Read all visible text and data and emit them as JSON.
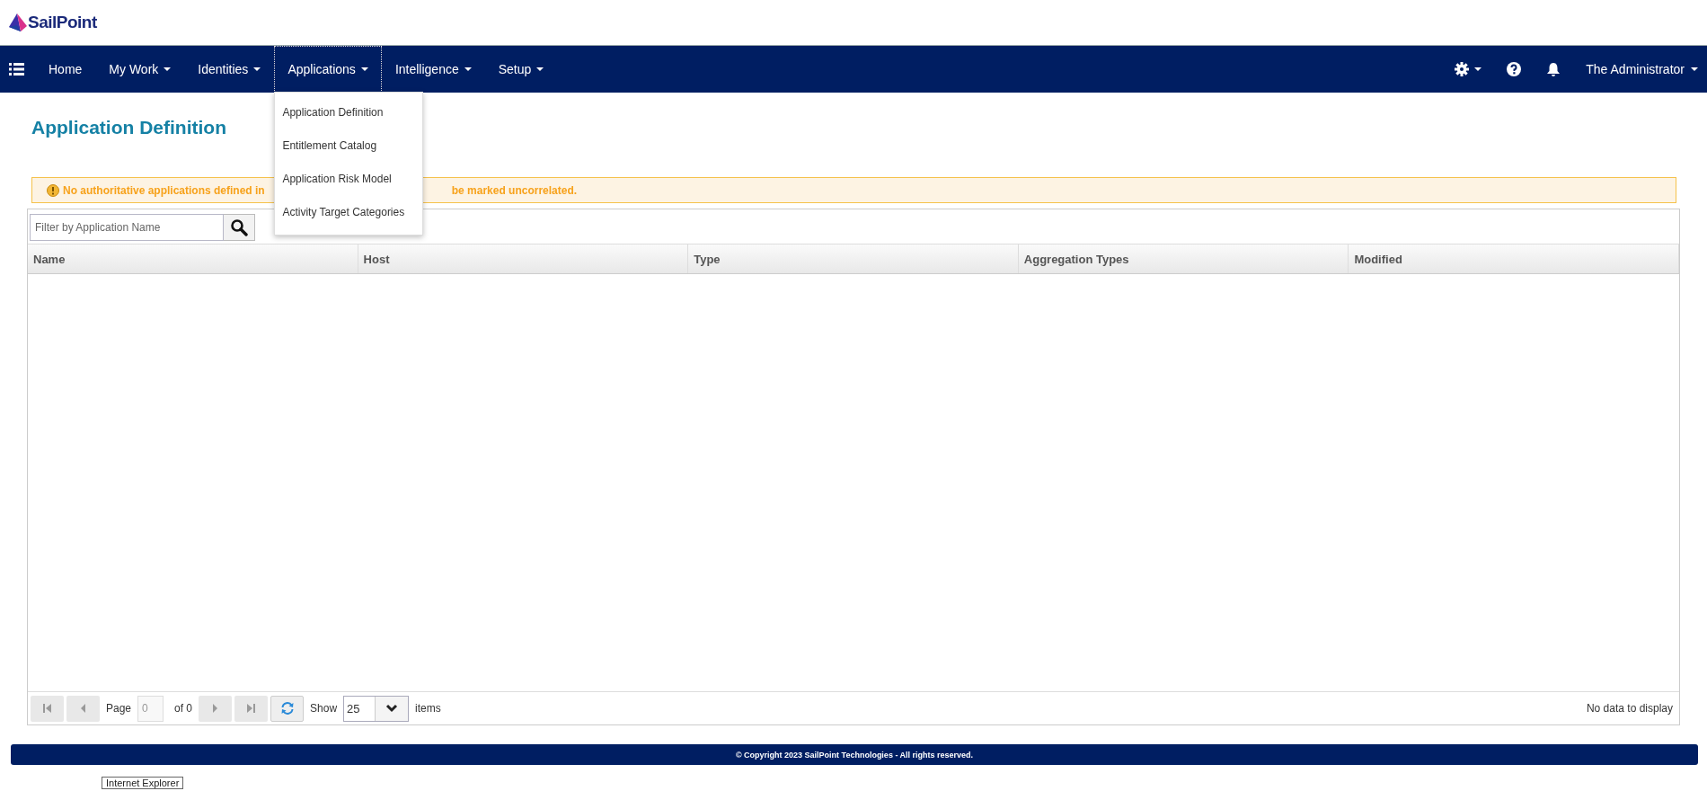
{
  "logo": {
    "text": "SailPoint"
  },
  "nav": {
    "items": [
      {
        "label": "Home",
        "has_caret": false,
        "expanded": false
      },
      {
        "label": "My Work",
        "has_caret": true,
        "expanded": false
      },
      {
        "label": "Identities",
        "has_caret": true,
        "expanded": false
      },
      {
        "label": "Applications",
        "has_caret": true,
        "expanded": true
      },
      {
        "label": "Intelligence",
        "has_caret": true,
        "expanded": false
      },
      {
        "label": "Setup",
        "has_caret": true,
        "expanded": false
      }
    ],
    "user": "The Administrator"
  },
  "menu": {
    "items": [
      "Application Definition",
      "Entitlement Catalog",
      "Application Risk Model",
      "Activity Target Categories"
    ]
  },
  "page": {
    "title": "Application Definition"
  },
  "warning": {
    "text_before": "No authoritative applications defined in",
    "text_after": "be marked uncorrelated."
  },
  "filter": {
    "placeholder": "Filter by Application Name"
  },
  "table": {
    "columns": [
      "Name",
      "Host",
      "Type",
      "Aggregation Types",
      "Modified"
    ]
  },
  "pager": {
    "buttons_before": [
      {
        "kind": "first",
        "disabled": true
      },
      {
        "kind": "prev",
        "disabled": true
      }
    ],
    "page_label": "Page",
    "page_value": "0",
    "of_label": "of 0",
    "buttons_after": [
      {
        "kind": "next",
        "disabled": true
      },
      {
        "kind": "last",
        "disabled": true
      }
    ],
    "show_label": "Show",
    "page_size": "25",
    "items_label": "items",
    "status": "No data to display"
  },
  "footer": {
    "text": "© Copyright 2023 SailPoint Technologies - All rights reserved."
  },
  "tooltip": {
    "text": "Internet Explorer"
  }
}
